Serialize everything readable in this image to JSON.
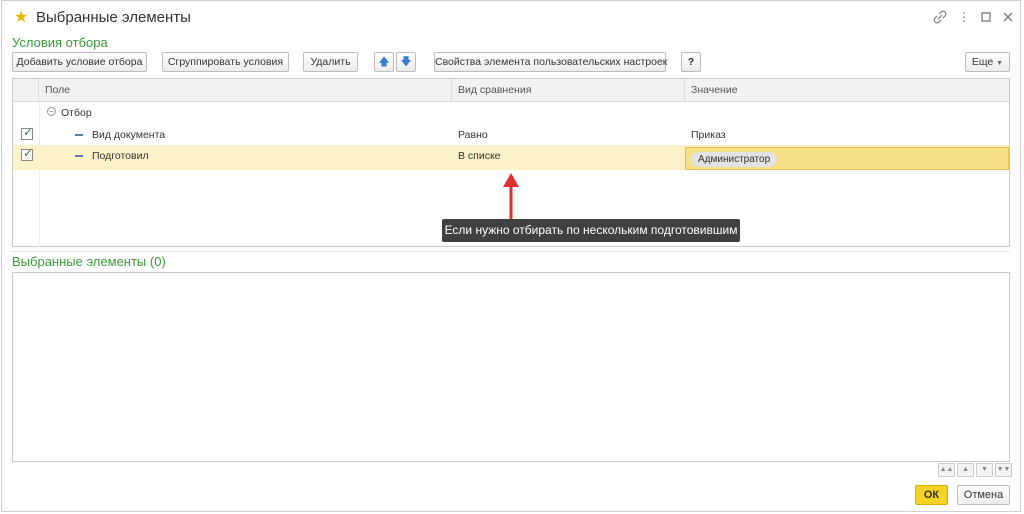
{
  "window": {
    "title": "Выбранные элементы",
    "star_icon": "star-icon",
    "title_icons": [
      "link-icon",
      "more-icon",
      "maximize-icon",
      "close-icon"
    ]
  },
  "filter_section": {
    "title": "Условия отбора",
    "toolbar": {
      "add_condition": "Добавить условие отбора",
      "group_conditions": "Сгруппировать условия",
      "delete": "Удалить",
      "move_up": "🡅",
      "move_down": "🡇",
      "element_properties": "Свойства элемента пользовательских настроек",
      "help": "?",
      "more": "Еще"
    },
    "columns": [
      "Поле",
      "Вид сравнения",
      "Значение"
    ],
    "group_label": "Отбор",
    "rows": [
      {
        "checked": true,
        "field": "Вид документа",
        "comparison": "Равно",
        "value": "Приказ"
      },
      {
        "checked": true,
        "field": "Подготовил",
        "comparison": "В списке",
        "value": "Администратор"
      }
    ]
  },
  "tooltip": {
    "text": "Если нужно отбирать по нескольким подготовившим",
    "arrow_color": "#e03030"
  },
  "selected_section": {
    "title": "Выбранные элементы (0)"
  },
  "nav_buttons": [
    "▲▲",
    "▲",
    "▼",
    "▼▼"
  ],
  "footer": {
    "ok": "ОК",
    "cancel": "Отмена"
  },
  "colors": {
    "accent_green": "#3a9a3a",
    "selected_row": "#fcf2c9",
    "value_highlight": "#f6df86",
    "ok_button": "#f5d324"
  }
}
